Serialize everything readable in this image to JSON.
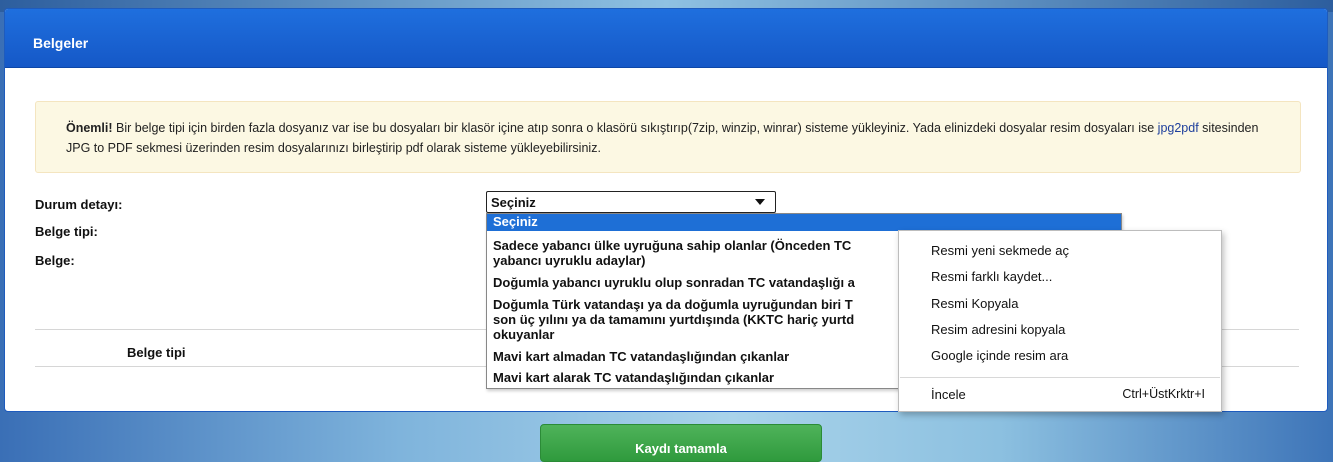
{
  "panel": {
    "title": "Belgeler"
  },
  "notice": {
    "strong": "Önemli!",
    "text1": " Bir belge tipi için birden fazla dosyanız var ise bu dosyaları bir klasör içine atıp sonra o klasörü sıkıştırıp(7zip, winzip, winrar) sisteme yükleyiniz. Yada elinizdeki dosyalar resim dosyaları ise ",
    "link": "jpg2pdf",
    "text2": " sitesinden JPG to PDF sekmesi üzerinden resim dosyalarınızı birleştirip pdf olarak sisteme yükleyebilirsiniz."
  },
  "form": {
    "durum_label": "Durum detayı:",
    "belge_tipi_label": "Belge tipi:",
    "belge_label": "Belge:",
    "select_value": "Seçiniz",
    "options": [
      "Seçiniz",
      "Sadece yabancı ülke uyruğuna sahip olanlar (Önceden TC",
      "yabancı uyruklu adaylar)",
      "Doğumla yabancı uyruklu olup sonradan TC vatandaşlığı a",
      "Doğumla Türk vatandaşı ya da doğumla uyruğundan biri T",
      "son üç yılını ya da tamamını yurtdışında (KKTC hariç yurtd",
      "okuyanlar",
      "Mavi kart almadan TC vatandaşlığından çıkanlar",
      "Mavi kart alarak TC vatandaşlığından çıkanlar"
    ]
  },
  "table": {
    "header_belge_tipi": "Belge tipi"
  },
  "context_menu": {
    "items": [
      "Resmi yeni sekmede aç",
      "Resmi farklı kaydet...",
      "Resmi Kopyala",
      "Resim adresini kopyala",
      "Google içinde resim ara",
      "İncele"
    ],
    "inspect_shortcut": "Ctrl+ÜstKrktr+I"
  },
  "submit": {
    "label": "Kaydı tamamla"
  }
}
